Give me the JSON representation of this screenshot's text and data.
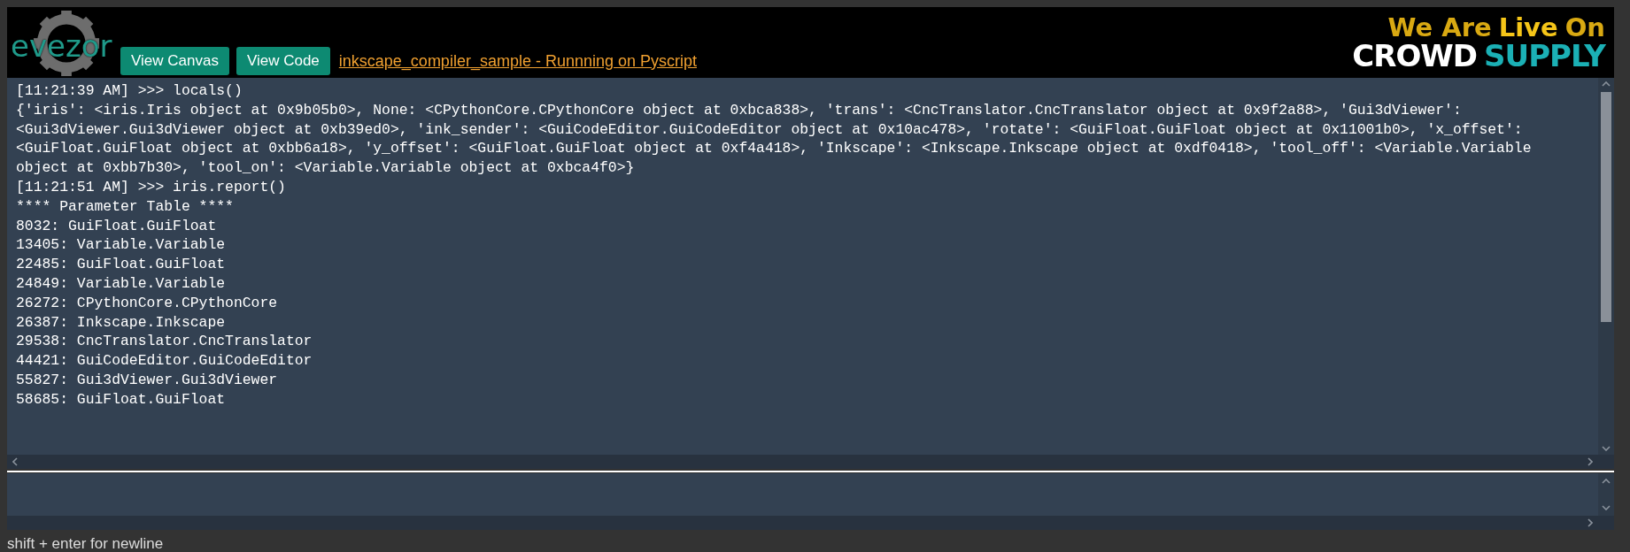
{
  "header": {
    "logo": "evezor",
    "buttons": [
      {
        "label": "View Canvas"
      },
      {
        "label": "View Code"
      }
    ],
    "title_link": "inkscape_compiler_sample - Runnning on Pyscript",
    "banner": {
      "tagline": [
        {
          "text": "We Are",
          "kind": "dim"
        },
        {
          "text": "Live",
          "kind": "bright"
        },
        {
          "text": "On",
          "kind": "dim"
        }
      ],
      "brand": [
        {
          "text": "CROWD",
          "kind": "white"
        },
        {
          "text": "SUPPLY",
          "kind": "teal"
        }
      ]
    }
  },
  "console": {
    "lines": [
      "[11:21:39 AM] >>> locals()",
      "{'iris': <iris.Iris object at 0x9b05b0>, None: <CPythonCore.CPythonCore object at 0xbca838>, 'trans': <CncTranslator.CncTranslator object at 0x9f2a88>, 'Gui3dViewer':",
      "<Gui3dViewer.Gui3dViewer object at 0xb39ed0>, 'ink_sender': <GuiCodeEditor.GuiCodeEditor object at 0x10ac478>, 'rotate': <GuiFloat.GuiFloat object at 0x11001b0>, 'x_offset':",
      "<GuiFloat.GuiFloat object at 0xbb6a18>, 'y_offset': <GuiFloat.GuiFloat object at 0xf4a418>, 'Inkscape': <Inkscape.Inkscape object at 0xdf0418>, 'tool_off': <Variable.Variable",
      "object at 0xbb7b30>, 'tool_on': <Variable.Variable object at 0xbca4f0>}",
      "[11:21:51 AM] >>> iris.report()",
      "**** Parameter Table ****",
      "8032: GuiFloat.GuiFloat",
      "13405: Variable.Variable",
      "22485: GuiFloat.GuiFloat",
      "24849: Variable.Variable",
      "26272: CPythonCore.CPythonCore",
      "26387: Inkscape.Inkscape",
      "29538: CncTranslator.CncTranslator",
      "44421: GuiCodeEditor.GuiCodeEditor",
      "55827: Gui3dViewer.Gui3dViewer",
      "58685: GuiFloat.GuiFloat"
    ]
  },
  "status_bar": "shift + enter for newline"
}
